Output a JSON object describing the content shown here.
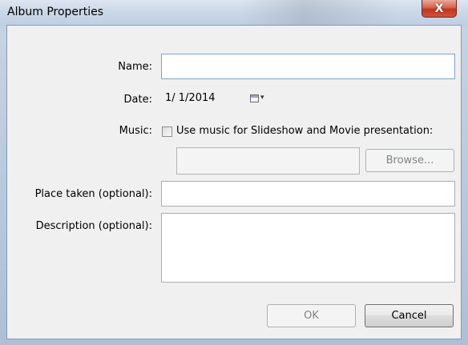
{
  "window": {
    "title": "Album Properties",
    "close_glyph": "X"
  },
  "form": {
    "name": {
      "label": "Name:",
      "value": ""
    },
    "date": {
      "label": "Date:",
      "value": "1/ 1/2014",
      "picker_arrow": "▾",
      "icon": "calendar-icon"
    },
    "music": {
      "label": "Music:",
      "checkbox_label": "Use music for Slideshow and Movie presentation:",
      "checked": false,
      "path_value": "",
      "browse_label": "Browse..."
    },
    "place": {
      "label": "Place taken (optional):",
      "value": ""
    },
    "description": {
      "label": "Description (optional):",
      "value": ""
    }
  },
  "buttons": {
    "ok": "OK",
    "cancel": "Cancel"
  }
}
